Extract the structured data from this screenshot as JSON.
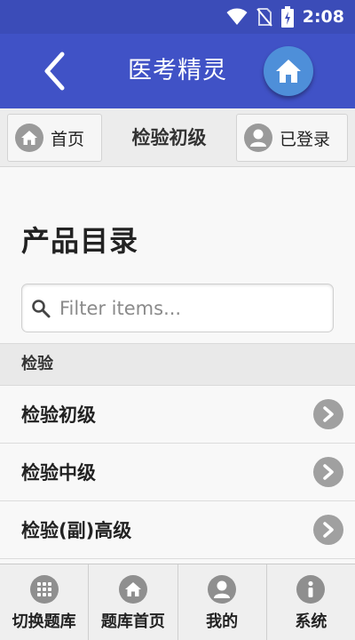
{
  "status_bar": {
    "time": "2:08"
  },
  "app_bar": {
    "title": "医考精灵"
  },
  "sub_header": {
    "home_label": "首页",
    "title": "检验初级",
    "login_label": "已登录"
  },
  "content": {
    "heading": "产品目录",
    "search": {
      "placeholder": "Filter items...",
      "value": ""
    },
    "divider": "检验",
    "items": [
      {
        "label": "检验初级"
      },
      {
        "label": "检验中级"
      },
      {
        "label": "检验(副)高级"
      }
    ]
  },
  "bottom_nav": [
    {
      "label": "切换题库",
      "icon": "grid-icon"
    },
    {
      "label": "题库首页",
      "icon": "home-icon"
    },
    {
      "label": "我的",
      "icon": "user-icon"
    },
    {
      "label": "系统",
      "icon": "info-icon"
    }
  ],
  "colors": {
    "app_bar": "#4052c6",
    "status_bar": "#3b4cb8",
    "home_circle": "#4e8fd9"
  }
}
